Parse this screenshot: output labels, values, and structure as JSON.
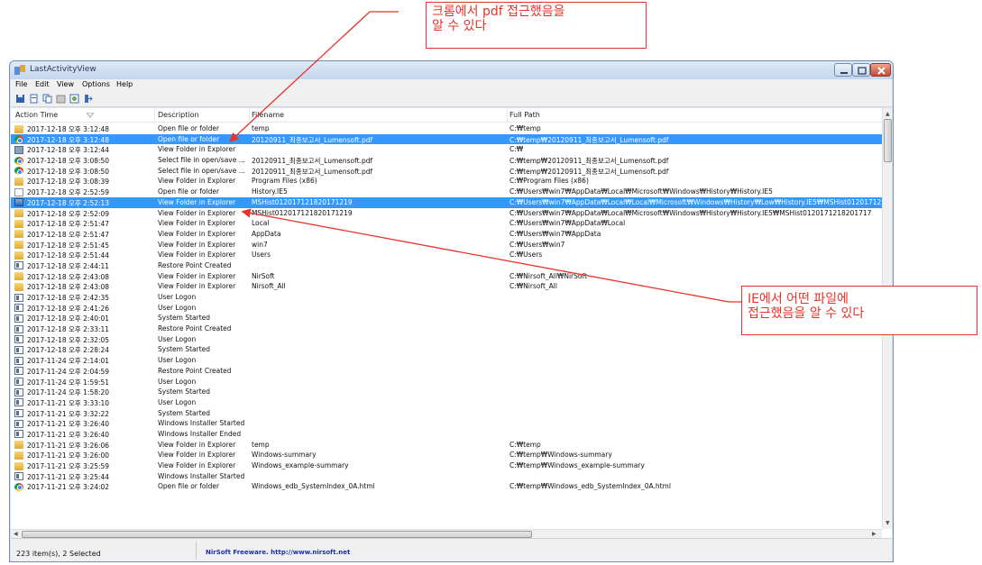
{
  "window": {
    "title": "LastActivityView",
    "menu": [
      "File",
      "Edit",
      "View",
      "Options",
      "Help"
    ]
  },
  "toolbar": {
    "buttons": [
      "save-icon",
      "report-icon",
      "copy-icon",
      "properties-icon",
      "html-report-icon",
      "exit-icon"
    ]
  },
  "columns": {
    "time": "Action Time",
    "desc": "Description",
    "file": "Filename",
    "path": "Full Path"
  },
  "rows": [
    {
      "icon": "folder",
      "time": "2017-12-18 오후 3:12:48",
      "desc": "Open file or folder",
      "file": "temp",
      "path": "C:₩temp",
      "sel": false
    },
    {
      "icon": "chrome",
      "time": "2017-12-18 오후 3:12:48",
      "desc": "Open file or folder",
      "file": "20120911_최종보고서_Lumensoft.pdf",
      "path": "C:₩temp₩20120911_최종보고서_Lumensoft.pdf",
      "sel": true
    },
    {
      "icon": "sys",
      "time": "2017-12-18 오후 3:12:44",
      "desc": "View Folder in Explorer",
      "file": "",
      "path": "C:₩",
      "sel": false
    },
    {
      "icon": "chrome",
      "time": "2017-12-18 오후 3:08:50",
      "desc": "Select file in open/save ...",
      "file": "20120911_최종보고서_Lumensoft.pdf",
      "path": "C:₩temp₩20120911_최종보고서_Lumensoft.pdf",
      "sel": false
    },
    {
      "icon": "chrome",
      "time": "2017-12-18 오후 3:08:50",
      "desc": "Select file in open/save ...",
      "file": "20120911_최종보고서_Lumensoft.pdf",
      "path": "C:₩temp₩20120911_최종보고서_Lumensoft.pdf",
      "sel": false
    },
    {
      "icon": "folder",
      "time": "2017-12-18 오후 3:08:39",
      "desc": "View Folder in Explorer",
      "file": "Program Files (x86)",
      "path": "C:₩Program Files (x86)",
      "sel": false
    },
    {
      "icon": "file",
      "time": "2017-12-18 오후 2:52:59",
      "desc": "Open file or folder",
      "file": "History.IE5",
      "path": "C:₩Users₩win7₩AppData₩Local₩Microsoft₩Windows₩History₩History.IE5",
      "sel": false
    },
    {
      "icon": "exp",
      "time": "2017-12-18 오후 2:52:13",
      "desc": "View Folder in Explorer",
      "file": "MSHist012017121820171219",
      "path": "C:₩Users₩win7₩AppData₩Local₩Local₩Microsoft₩Windows₩History₩Low₩History.IE5₩MSHist01201712182",
      "sel": true
    },
    {
      "icon": "folder",
      "time": "2017-12-18 오후 2:52:09",
      "desc": "View Folder in Explorer",
      "file": "MSHist012017121820171219",
      "path": "C:₩Users₩win7₩AppData₩Local₩Microsoft₩Windows₩History₩History.IE5₩MSHist0120171218201717",
      "sel": false
    },
    {
      "icon": "folder",
      "time": "2017-12-18 오후 2:51:47",
      "desc": "View Folder in Explorer",
      "file": "Local",
      "path": "C:₩Users₩win7₩AppData₩Local",
      "sel": false
    },
    {
      "icon": "folder",
      "time": "2017-12-18 오후 2:51:47",
      "desc": "View Folder in Explorer",
      "file": "AppData",
      "path": "C:₩Users₩win7₩AppData",
      "sel": false
    },
    {
      "icon": "folder",
      "time": "2017-12-18 오후 2:51:45",
      "desc": "View Folder in Explorer",
      "file": "win7",
      "path": "C:₩Users₩win7",
      "sel": false
    },
    {
      "icon": "folder",
      "time": "2017-12-18 오후 2:51:44",
      "desc": "View Folder in Explorer",
      "file": "Users",
      "path": "C:₩Users",
      "sel": false
    },
    {
      "icon": "evt",
      "time": "2017-12-18 오후 2:44:11",
      "desc": "Restore Point Created",
      "file": "",
      "path": "",
      "sel": false
    },
    {
      "icon": "folder",
      "time": "2017-12-18 오후 2:43:08",
      "desc": "View Folder in Explorer",
      "file": "NirSoft",
      "path": "C:₩Nirsoft_All₩NirSoft",
      "sel": false
    },
    {
      "icon": "folder",
      "time": "2017-12-18 오후 2:43:08",
      "desc": "View Folder in Explorer",
      "file": "Nirsoft_All",
      "path": "C:₩Nirsoft_All",
      "sel": false
    },
    {
      "icon": "evt",
      "time": "2017-12-18 오후 2:42:35",
      "desc": "User Logon",
      "file": "",
      "path": "",
      "sel": false
    },
    {
      "icon": "evt",
      "time": "2017-12-18 오후 2:41:26",
      "desc": "User Logon",
      "file": "",
      "path": "",
      "sel": false
    },
    {
      "icon": "evt",
      "time": "2017-12-18 오후 2:40:01",
      "desc": "System Started",
      "file": "",
      "path": "",
      "sel": false
    },
    {
      "icon": "evt",
      "time": "2017-12-18 오후 2:33:11",
      "desc": "Restore Point Created",
      "file": "",
      "path": "",
      "sel": false
    },
    {
      "icon": "evt",
      "time": "2017-12-18 오후 2:32:05",
      "desc": "User Logon",
      "file": "",
      "path": "",
      "sel": false
    },
    {
      "icon": "evt",
      "time": "2017-12-18 오후 2:28:24",
      "desc": "System Started",
      "file": "",
      "path": "",
      "sel": false
    },
    {
      "icon": "evt",
      "time": "2017-11-24 오후 2:14:01",
      "desc": "User Logon",
      "file": "",
      "path": "",
      "sel": false
    },
    {
      "icon": "evt",
      "time": "2017-11-24 오후 2:04:59",
      "desc": "Restore Point Created",
      "file": "",
      "path": "",
      "sel": false
    },
    {
      "icon": "evt",
      "time": "2017-11-24 오후 1:59:51",
      "desc": "User Logon",
      "file": "",
      "path": "",
      "sel": false
    },
    {
      "icon": "evt",
      "time": "2017-11-24 오후 1:58:20",
      "desc": "System Started",
      "file": "",
      "path": "",
      "sel": false
    },
    {
      "icon": "evt",
      "time": "2017-11-21 오후 3:33:10",
      "desc": "User Logon",
      "file": "",
      "path": "",
      "sel": false
    },
    {
      "icon": "evt",
      "time": "2017-11-21 오후 3:32:22",
      "desc": "System Started",
      "file": "",
      "path": "",
      "sel": false
    },
    {
      "icon": "evt",
      "time": "2017-11-21 오후 3:26:40",
      "desc": "Windows Installer Started",
      "file": "",
      "path": "",
      "sel": false
    },
    {
      "icon": "evt",
      "time": "2017-11-21 오후 3:26:40",
      "desc": "Windows Installer Ended",
      "file": "",
      "path": "",
      "sel": false
    },
    {
      "icon": "folder",
      "time": "2017-11-21 오후 3:26:06",
      "desc": "View Folder in Explorer",
      "file": "temp",
      "path": "C:₩temp",
      "sel": false
    },
    {
      "icon": "folder",
      "time": "2017-11-21 오후 3:26:00",
      "desc": "View Folder in Explorer",
      "file": "Windows-summary",
      "path": "C:₩temp₩Windows-summary",
      "sel": false
    },
    {
      "icon": "folder",
      "time": "2017-11-21 오후 3:25:59",
      "desc": "View Folder in Explorer",
      "file": "Windows_example-summary",
      "path": "C:₩temp₩Windows_example-summary",
      "sel": false
    },
    {
      "icon": "evt",
      "time": "2017-11-21 오후 3:25:44",
      "desc": "Windows Installer Started",
      "file": "",
      "path": "",
      "sel": false
    },
    {
      "icon": "chrome",
      "time": "2017-11-21 오후 3:24:02",
      "desc": "Open file or folder",
      "file": "Windows_edb_SystemIndex_0A.html",
      "path": "C:₩temp₩Windows_edb_SystemIndex_0A.html",
      "sel": false
    }
  ],
  "status": {
    "count": "223 item(s), 2 Selected",
    "link": "NirSoft Freeware.  http://www.nirsoft.net"
  },
  "annotations": {
    "top": [
      "크롬에서 pdf 접근했음을",
      "알 수 있다"
    ],
    "right": [
      "IE에서 어떤 파일에",
      "접근했음을 알 수 있다"
    ],
    "color": "#e8332a"
  }
}
